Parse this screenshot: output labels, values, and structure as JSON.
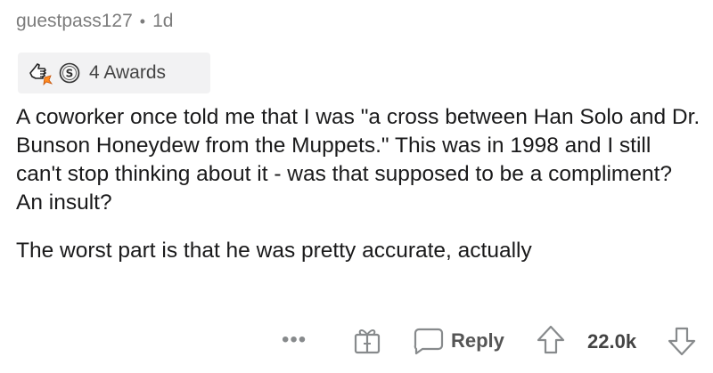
{
  "comment": {
    "author": "guestpass127",
    "separator": "•",
    "age": "1d",
    "awards": {
      "icons": [
        "helpful-hand-icon",
        "silver-award-icon"
      ],
      "label": "4 Awards"
    },
    "body": {
      "paragraph1": "A coworker once told me that I was \"a cross between Han Solo and Dr. Bunson Honeydew from the Muppets.\" This was in 1998 and I still can't stop thinking about it - was that supposed to be a compliment? An insult?",
      "paragraph2": "The worst part is that he was pretty accurate, actually"
    },
    "actions": {
      "more": "•••",
      "reply_label": "Reply",
      "score": "22.0k"
    }
  }
}
